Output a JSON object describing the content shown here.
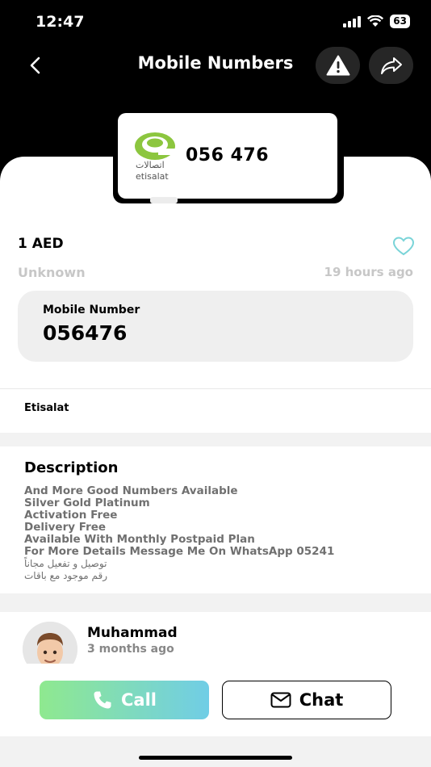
{
  "status_bar": {
    "time": "12:47",
    "battery": "63"
  },
  "header": {
    "title": "Mobile Numbers"
  },
  "plate": {
    "logo_arabic": "اتصالات",
    "logo_english": "etisalat",
    "number": "056 476"
  },
  "listing": {
    "price": "1 AED",
    "location": "Unknown",
    "posted": "19 hours ago",
    "number_label": "Mobile Number",
    "number_value": "056476",
    "operator": "Etisalat"
  },
  "description": {
    "heading": "Description",
    "lines": [
      "And More Good Numbers Available",
      "Silver Gold Platinum",
      "Activation Free",
      "Delivery Free",
      "Available With Monthly Postpaid Plan",
      "For More Details Message Me On WhatsApp 05241",
      "توصيل و تفعيل مجاناً",
      "رقم موجود مع باقات"
    ]
  },
  "seller": {
    "name": "Muhammad",
    "joined": "3 months ago"
  },
  "actions": {
    "call_label": "Call",
    "chat_label": "Chat"
  },
  "colors": {
    "call_gradient_start": "#8fe98f",
    "call_gradient_end": "#70cde6",
    "heart": "#7ad4d8",
    "brand_green": "#8cc63f"
  },
  "icons": [
    "back-arrow-icon",
    "warning-icon",
    "share-icon",
    "heart-icon",
    "phone-icon",
    "mail-icon",
    "etisalat-logo"
  ]
}
